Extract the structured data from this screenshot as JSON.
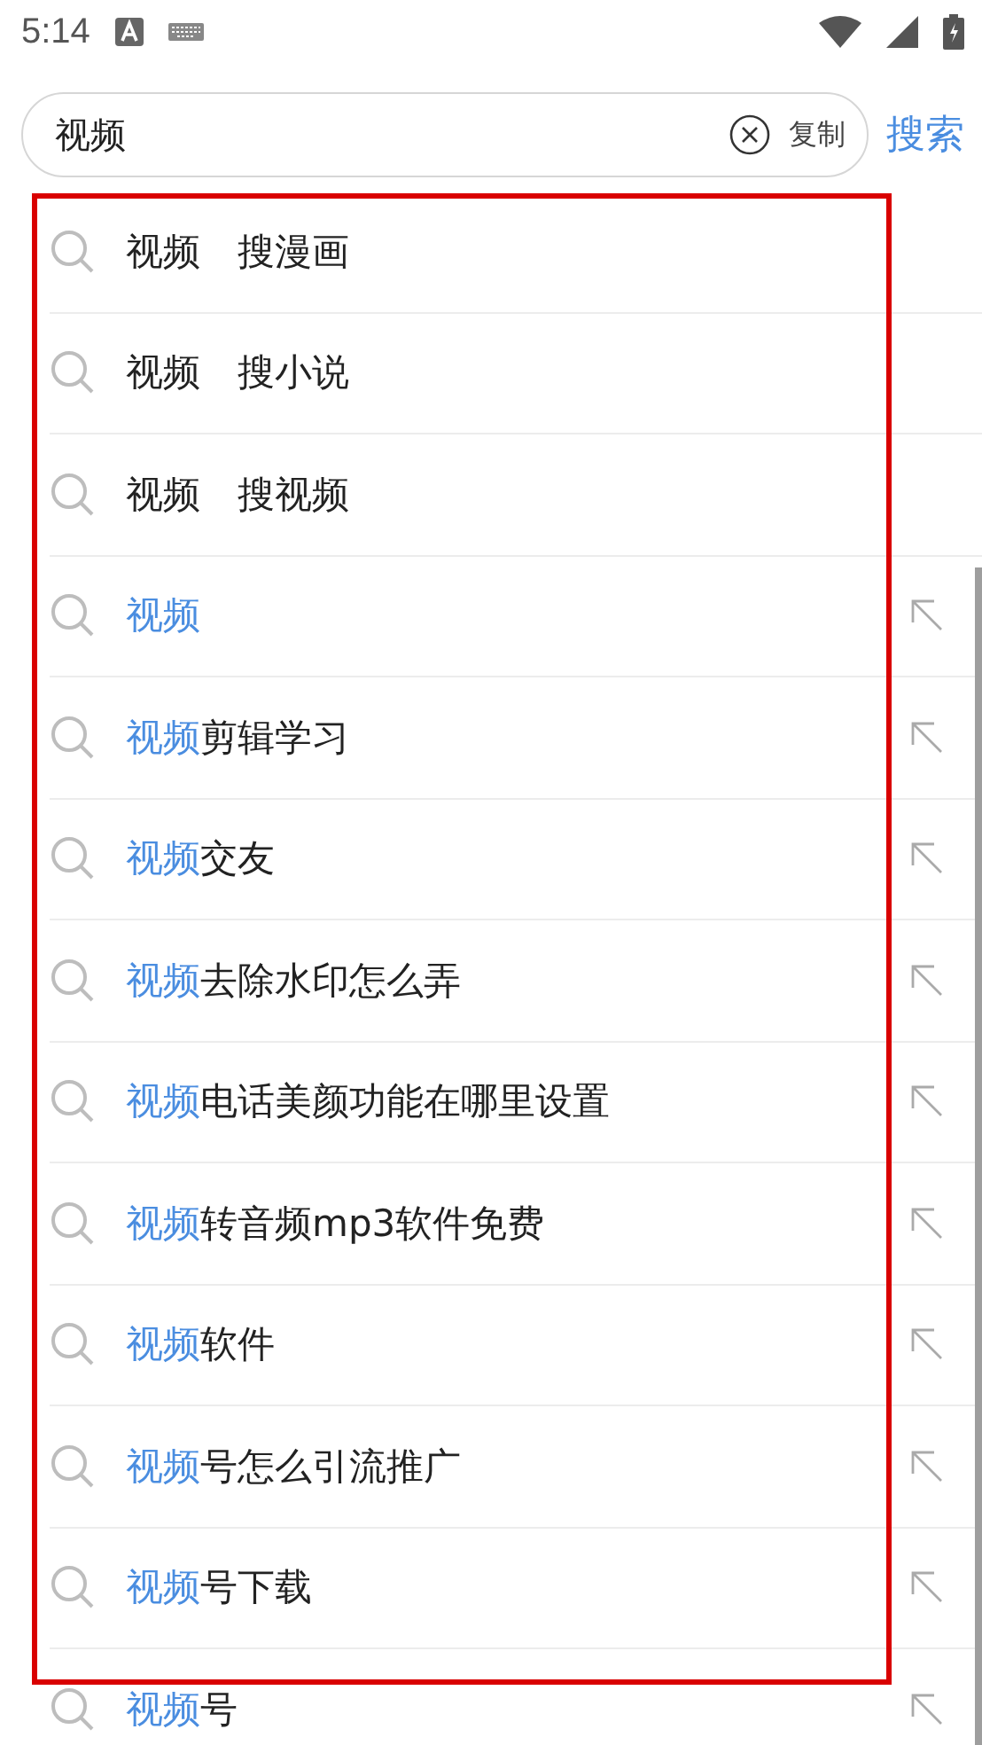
{
  "status_bar": {
    "time": "5:14"
  },
  "search": {
    "value": "视频",
    "copy_label": "复制",
    "search_label": "搜索"
  },
  "rows": [
    {
      "kind": "channel",
      "text": "视频　搜漫画"
    },
    {
      "kind": "channel",
      "text": "视频　搜小说"
    },
    {
      "kind": "channel",
      "text": "视频　搜视频"
    },
    {
      "kind": "suggestion",
      "match": "视频",
      "rest": ""
    },
    {
      "kind": "suggestion",
      "match": "视频",
      "rest": "剪辑学习"
    },
    {
      "kind": "suggestion",
      "match": "视频",
      "rest": "交友"
    },
    {
      "kind": "suggestion",
      "match": "视频",
      "rest": "去除水印怎么弄"
    },
    {
      "kind": "suggestion",
      "match": "视频",
      "rest": "电话美颜功能在哪里设置"
    },
    {
      "kind": "suggestion",
      "match": "视频",
      "rest": "转音频mp3软件免费"
    },
    {
      "kind": "suggestion",
      "match": "视频",
      "rest": "软件"
    },
    {
      "kind": "suggestion",
      "match": "视频",
      "rest": "号怎么引流推广"
    },
    {
      "kind": "suggestion",
      "match": "视频",
      "rest": "号下载"
    },
    {
      "kind": "suggestion",
      "match": "视频",
      "rest": "号"
    }
  ]
}
